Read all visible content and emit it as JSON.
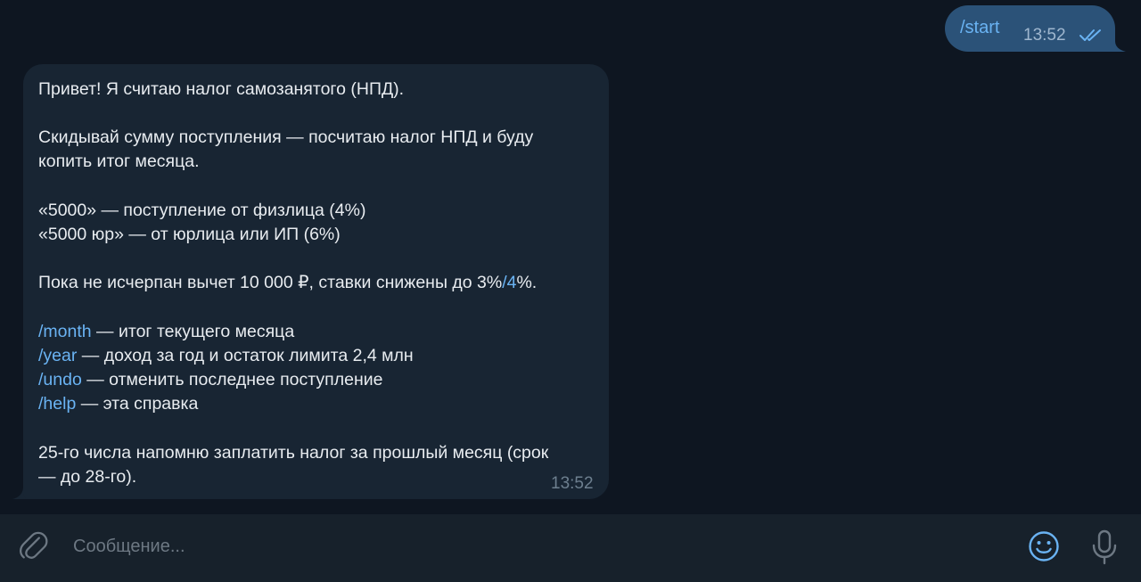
{
  "outgoing": {
    "text": "/start",
    "time": "13:52",
    "status_icon": "double-check-icon"
  },
  "incoming": {
    "lines": [
      {
        "text": "Привет! Я считаю налог самозанятого (НПД)."
      },
      {
        "text": "Скидывай сумму поступления — посчитаю налог НПД и буду"
      },
      {
        "text": "копить итог месяца."
      },
      {
        "text": "«5000» — поступление от физлица (4%)"
      },
      {
        "text": "«5000 юр» — от юрлица или ИП (6%)"
      },
      {
        "before": "Пока не исчерпан вычет 10 000 ₽, ставки снижены до 3%",
        "link": "/4",
        "after": "%."
      },
      {
        "cmd": "/month",
        "rest": " — итог текущего месяца"
      },
      {
        "cmd": "/year",
        "rest": " — доход за год и остаток лимита 2,4 млн"
      },
      {
        "cmd": "/undo",
        "rest": " — отменить последнее поступление"
      },
      {
        "cmd": "/help",
        "rest": " — эта справка"
      },
      {
        "text": "25-го числа напомню заплатить налог за прошлый месяц (срок"
      },
      {
        "text": "— до 28-го)."
      }
    ],
    "time": "13:52"
  },
  "composer": {
    "placeholder": "Сообщение...",
    "value": "",
    "attach_icon": "paperclip-icon",
    "emoji_icon": "smiley-icon",
    "mic_icon": "microphone-icon"
  },
  "colors": {
    "background": "#0e1621",
    "outgoing_bubble": "#2b5278",
    "incoming_bubble": "#182533",
    "composer": "#17212b",
    "link": "#6ab3f3"
  }
}
